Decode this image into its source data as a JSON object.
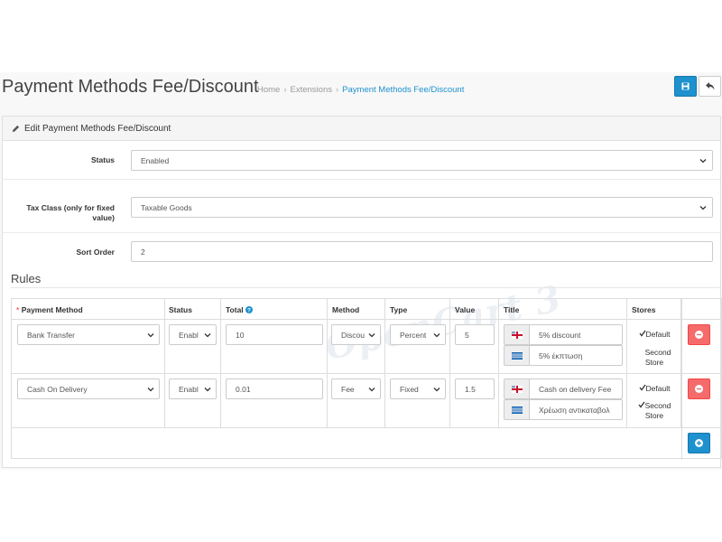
{
  "header": {
    "title": "Payment Methods Fee/Discount",
    "breadcrumb": [
      "Home",
      "Extensions",
      "Payment Methods Fee/Discount"
    ],
    "save_icon": "save-icon",
    "back_icon": "reply-icon"
  },
  "panel": {
    "heading": "Edit Payment Methods Fee/Discount",
    "heading_icon": "pencil-icon"
  },
  "form": {
    "status": {
      "label": "Status",
      "value": "Enabled"
    },
    "tax_class": {
      "label": "Tax Class (only for fixed value)",
      "value": "Taxable Goods"
    },
    "sort_order": {
      "label": "Sort Order",
      "value": "2"
    }
  },
  "rules": {
    "title": "Rules",
    "columns": [
      "Payment Method",
      "Status",
      "Total",
      "Method",
      "Type",
      "Value",
      "Title",
      "Stores"
    ],
    "rows": [
      {
        "payment_method": "Bank Transfer",
        "status": "Enabl",
        "total": "10",
        "method": "Discou",
        "type": "Percent",
        "value": "5",
        "title_en": "5% discount",
        "title_el": "5% έκπτωση",
        "stores": [
          {
            "name": "Default",
            "checked": true
          },
          {
            "name": "Second Store",
            "checked": false
          }
        ]
      },
      {
        "payment_method": "Cash On Delivery",
        "status": "Enabl",
        "total": "0.01",
        "method": "Fee",
        "type": "Fixed",
        "value": "1.5",
        "title_en": "Cash on delivery Fee",
        "title_el": "Χρέωση αντικαταβολ",
        "stores": [
          {
            "name": "Default",
            "checked": true
          },
          {
            "name": "Second Store",
            "checked": true
          }
        ]
      }
    ]
  },
  "watermark": "OpenCart 3",
  "colors": {
    "primary": "#1e91cf",
    "danger": "#f56b6b",
    "required": "#f56b6b"
  }
}
